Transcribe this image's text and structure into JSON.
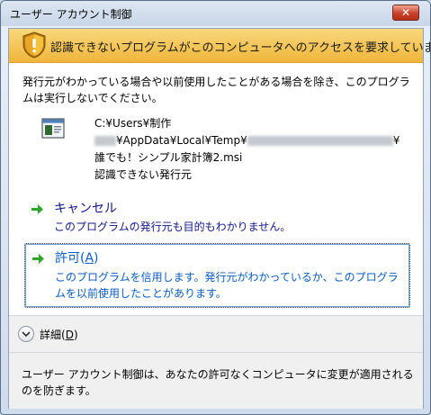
{
  "window": {
    "title": "ユーザー アカウント制御",
    "close_glyph": "✕"
  },
  "banner": {
    "icon": "warning-shield-icon",
    "text": "認識できないプログラムがこのコンピュータへのアクセスを要求しています"
  },
  "intro": {
    "line1": "発行元がわかっている場合や以前使用したことがある場合を除き、このプログラ",
    "line2": "ムは実行しないでください。"
  },
  "program": {
    "icon": "program-window-icon",
    "path_line1": "C:¥Users¥制作",
    "path_line2_prefix": "¥AppData¥Local¥Temp¥",
    "path_line2_suffix": "¥",
    "name": "誰でも！シンプル家計簿2.msi",
    "publisher": "認識できない発行元"
  },
  "options": {
    "cancel": {
      "title": "キャンセル",
      "description": "このプログラムの発行元も目的もわかりません。"
    },
    "allow": {
      "title_prefix": "許可(",
      "title_key": "A",
      "title_suffix": ")",
      "description": "このプログラムを信用します。発行元がわかっているか、このプログラムを以前使用したことがあります。"
    }
  },
  "details": {
    "label_prefix": "詳細(",
    "label_key": "D",
    "label_suffix": ")"
  },
  "footer": {
    "text": "ユーザー アカウント制御は、あなたの許可なくコンピュータに変更が適用されるのを防ぎます。"
  },
  "colors": {
    "banner_top": "#f9d77d",
    "banner_bottom": "#efb63a",
    "link_blue": "#0b5bc0",
    "dark_blue": "#12178a",
    "arrow_green": "#2fa52a"
  }
}
